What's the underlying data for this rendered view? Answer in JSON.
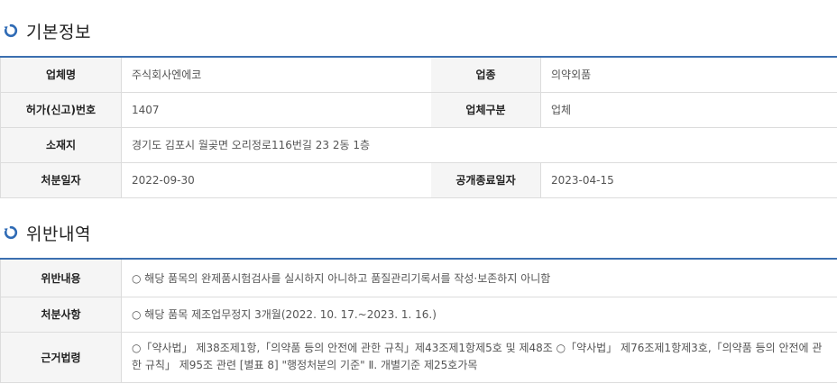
{
  "sections": {
    "basic_info_title": "기본정보",
    "violation_title": "위반내역"
  },
  "basic_info": {
    "company_name_label": "업체명",
    "company_name_value": "주식회사엔에코",
    "industry_label": "업종",
    "industry_value": "의약외품",
    "license_label": "허가(신고)번호",
    "license_value": "1407",
    "company_type_label": "업체구분",
    "company_type_value": "업체",
    "address_label": "소재지",
    "address_value": "경기도 김포시 월곶면 오리정로116번길 23 2동 1층",
    "disposition_date_label": "처분일자",
    "disposition_date_value": "2022-09-30",
    "disclosure_end_label": "공개종료일자",
    "disclosure_end_value": "2023-04-15"
  },
  "violation": {
    "content_label": "위반내용",
    "content_value": "○ 해당 품목의 완제품시험검사를 실시하지 아니하고 품질관리기록서를 작성·보존하지 아니함",
    "disposition_label": "처분사항",
    "disposition_value": "○ 해당 품목 제조업무정지 3개월(2022. 10. 17.~2023. 1. 16.)",
    "legal_basis_label": "근거법령",
    "legal_basis_value": "○「약사법」 제38조제1항,「의약품 등의 안전에 관한 규칙」제43조제1항제5호 및 제48조 ○「약사법」 제76조제1항제3호,「의약품 등의 안전에 관한 규칙」 제95조 관련 [별표 8] \"행정처분의 기준\" Ⅱ. 개별기준 제25호가목"
  },
  "colors": {
    "accent": "#3b6fb0",
    "header_bg": "#f5f5f5",
    "border": "#dcdcdc"
  },
  "icons": {
    "section_icon": "refresh-circle-icon"
  }
}
